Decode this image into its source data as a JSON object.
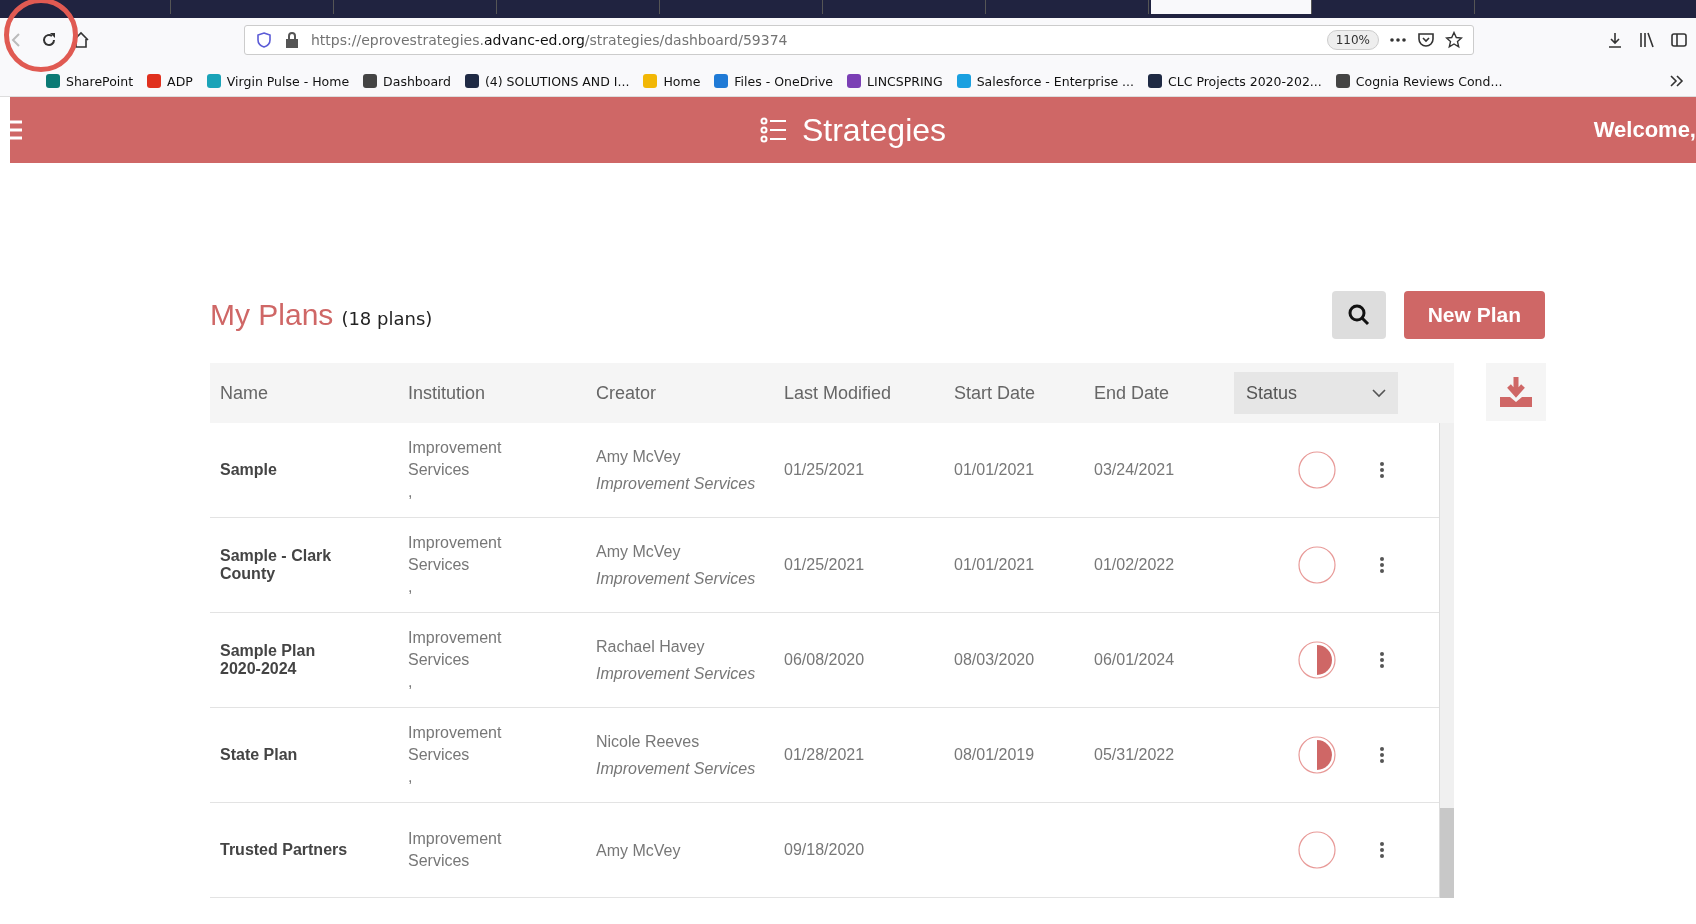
{
  "browser": {
    "tabs": [
      {
        "selected": false
      },
      {
        "selected": false
      },
      {
        "selected": false
      },
      {
        "selected": false
      },
      {
        "selected": false
      },
      {
        "selected": false
      },
      {
        "selected": false
      },
      {
        "selected": true
      },
      {
        "selected": false
      }
    ],
    "url": {
      "prefix": "https://eprovestrategies.",
      "domain": "advanc-ed.org",
      "path": "/strategies/dashboard/59374"
    },
    "zoom": "110%",
    "bookmarks": [
      {
        "label": "SharePoint",
        "color": "#0b7a75"
      },
      {
        "label": "ADP",
        "color": "#e0301e"
      },
      {
        "label": "Virgin Pulse - Home",
        "color": "#1aa3b8"
      },
      {
        "label": "Dashboard",
        "color": "#444444"
      },
      {
        "label": "(4) SOLUTIONS AND I...",
        "color": "#1f2a44"
      },
      {
        "label": "Home",
        "color": "#f2b705"
      },
      {
        "label": "Files - OneDrive",
        "color": "#1f7ad6"
      },
      {
        "label": "LINCSPRING",
        "color": "#7b3fb5"
      },
      {
        "label": "Salesforce - Enterprise ...",
        "color": "#1aa0e0"
      },
      {
        "label": "CLC Projects 2020-202...",
        "color": "#1f2a44"
      },
      {
        "label": "Cognia Reviews Cond...",
        "color": "#444444"
      }
    ]
  },
  "header": {
    "title": "Strategies",
    "welcome": "Welcome,"
  },
  "plans": {
    "title": "My Plans",
    "count": "(18 plans)",
    "new_button": "New Plan"
  },
  "table": {
    "columns": [
      "Name",
      "Institution",
      "Creator",
      "Last Modified",
      "Start Date",
      "End Date"
    ],
    "status_filter": "Status",
    "rows": [
      {
        "name": "Sample",
        "institution": "Improvement Services",
        "institution_extra": ",",
        "creator": "Amy McVey",
        "creator_org": "Improvement Services",
        "last_modified": "01/25/2021",
        "start_date": "01/01/2021",
        "end_date": "03/24/2021",
        "kind": "empty"
      },
      {
        "name": "Sample - Clark County",
        "institution": "Improvement Services",
        "institution_extra": ",",
        "creator": "Amy McVey",
        "creator_org": "Improvement Services",
        "last_modified": "01/25/2021",
        "start_date": "01/01/2021",
        "end_date": "01/02/2022",
        "kind": "empty"
      },
      {
        "name": "Sample Plan 2020-2024",
        "institution": "Improvement Services",
        "institution_extra": ",",
        "creator": "Rachael Havey",
        "creator_org": "Improvement Services",
        "last_modified": "06/08/2020",
        "start_date": "08/03/2020",
        "end_date": "06/01/2024",
        "kind": "half"
      },
      {
        "name": "State Plan",
        "institution": "Improvement Services",
        "institution_extra": ",",
        "creator": "Nicole Reeves",
        "creator_org": "Improvement Services",
        "last_modified": "01/28/2021",
        "start_date": "08/01/2019",
        "end_date": "05/31/2022",
        "kind": "half"
      },
      {
        "name": "Trusted Partners",
        "institution": "Improvement Services",
        "creator": "Amy McVey",
        "last_modified": "09/18/2020",
        "kind": "empty"
      }
    ]
  }
}
